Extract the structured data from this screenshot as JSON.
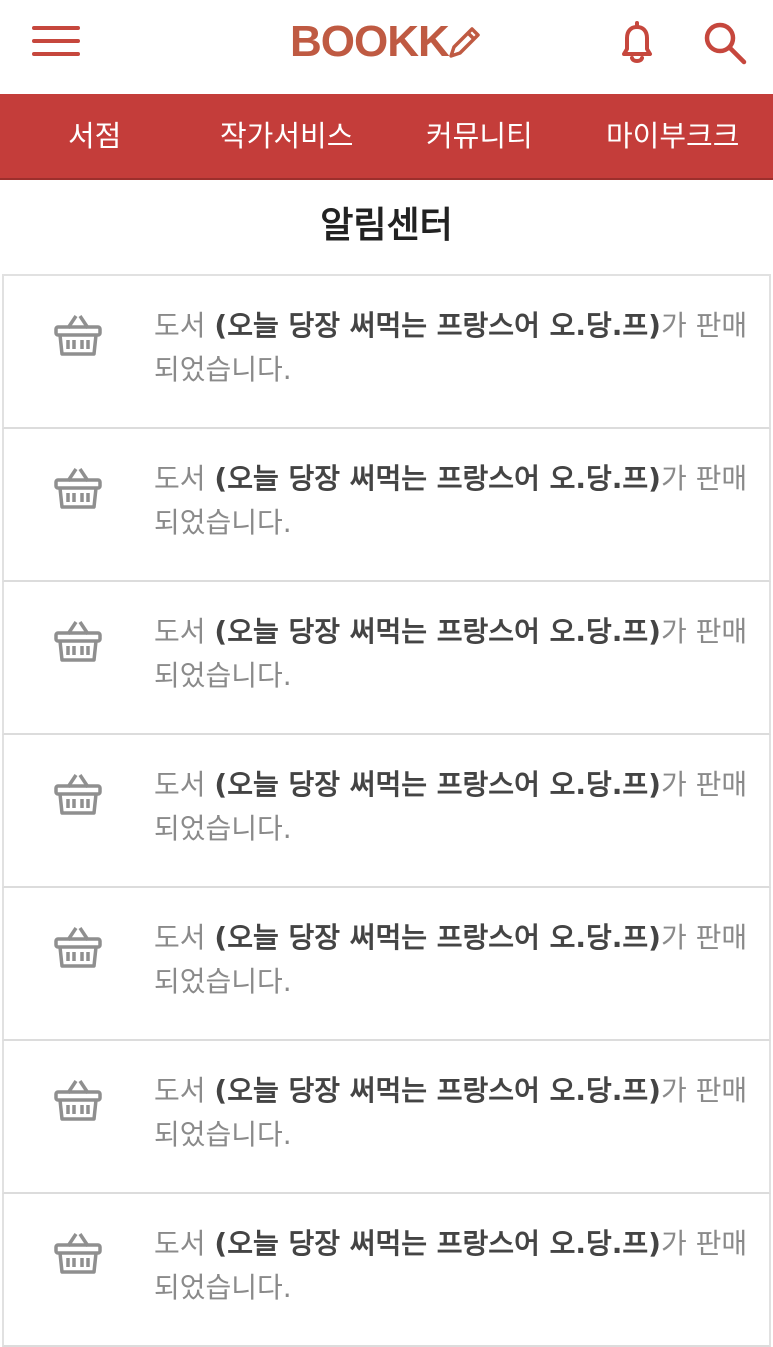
{
  "header": {
    "logo_text": "BOOKK",
    "brand_color": "#c6473d",
    "icons": [
      "menu-icon",
      "pencil-icon",
      "bell-icon",
      "search-icon"
    ]
  },
  "nav": {
    "background": "#c43d3a",
    "items": [
      {
        "label": "서점"
      },
      {
        "label": "작가서비스"
      },
      {
        "label": "커뮤니티"
      },
      {
        "label": "마이부크크"
      }
    ]
  },
  "page": {
    "title": "알림센터"
  },
  "notifications": [
    {
      "prefix": "도서 ",
      "book": "(오늘 당장 써먹는 프랑스어 오.당.프)",
      "suffix": "가 판매되었습니다.",
      "icon": "basket-icon"
    },
    {
      "prefix": "도서 ",
      "book": "(오늘 당장 써먹는 프랑스어 오.당.프)",
      "suffix": "가 판매되었습니다.",
      "icon": "basket-icon"
    },
    {
      "prefix": "도서 ",
      "book": "(오늘 당장 써먹는 프랑스어 오.당.프)",
      "suffix": "가 판매되었습니다.",
      "icon": "basket-icon"
    },
    {
      "prefix": "도서 ",
      "book": "(오늘 당장 써먹는 프랑스어 오.당.프)",
      "suffix": "가 판매되었습니다.",
      "icon": "basket-icon"
    },
    {
      "prefix": "도서 ",
      "book": "(오늘 당장 써먹는 프랑스어 오.당.프)",
      "suffix": "가 판매되었습니다.",
      "icon": "basket-icon"
    },
    {
      "prefix": "도서 ",
      "book": "(오늘 당장 써먹는 프랑스어 오.당.프)",
      "suffix": "가 판매되었습니다.",
      "icon": "basket-icon"
    },
    {
      "prefix": "도서 ",
      "book": "(오늘 당장 써먹는 프랑스어 오.당.프)",
      "suffix": "가 판매되었습니다.",
      "icon": "basket-icon"
    }
  ]
}
